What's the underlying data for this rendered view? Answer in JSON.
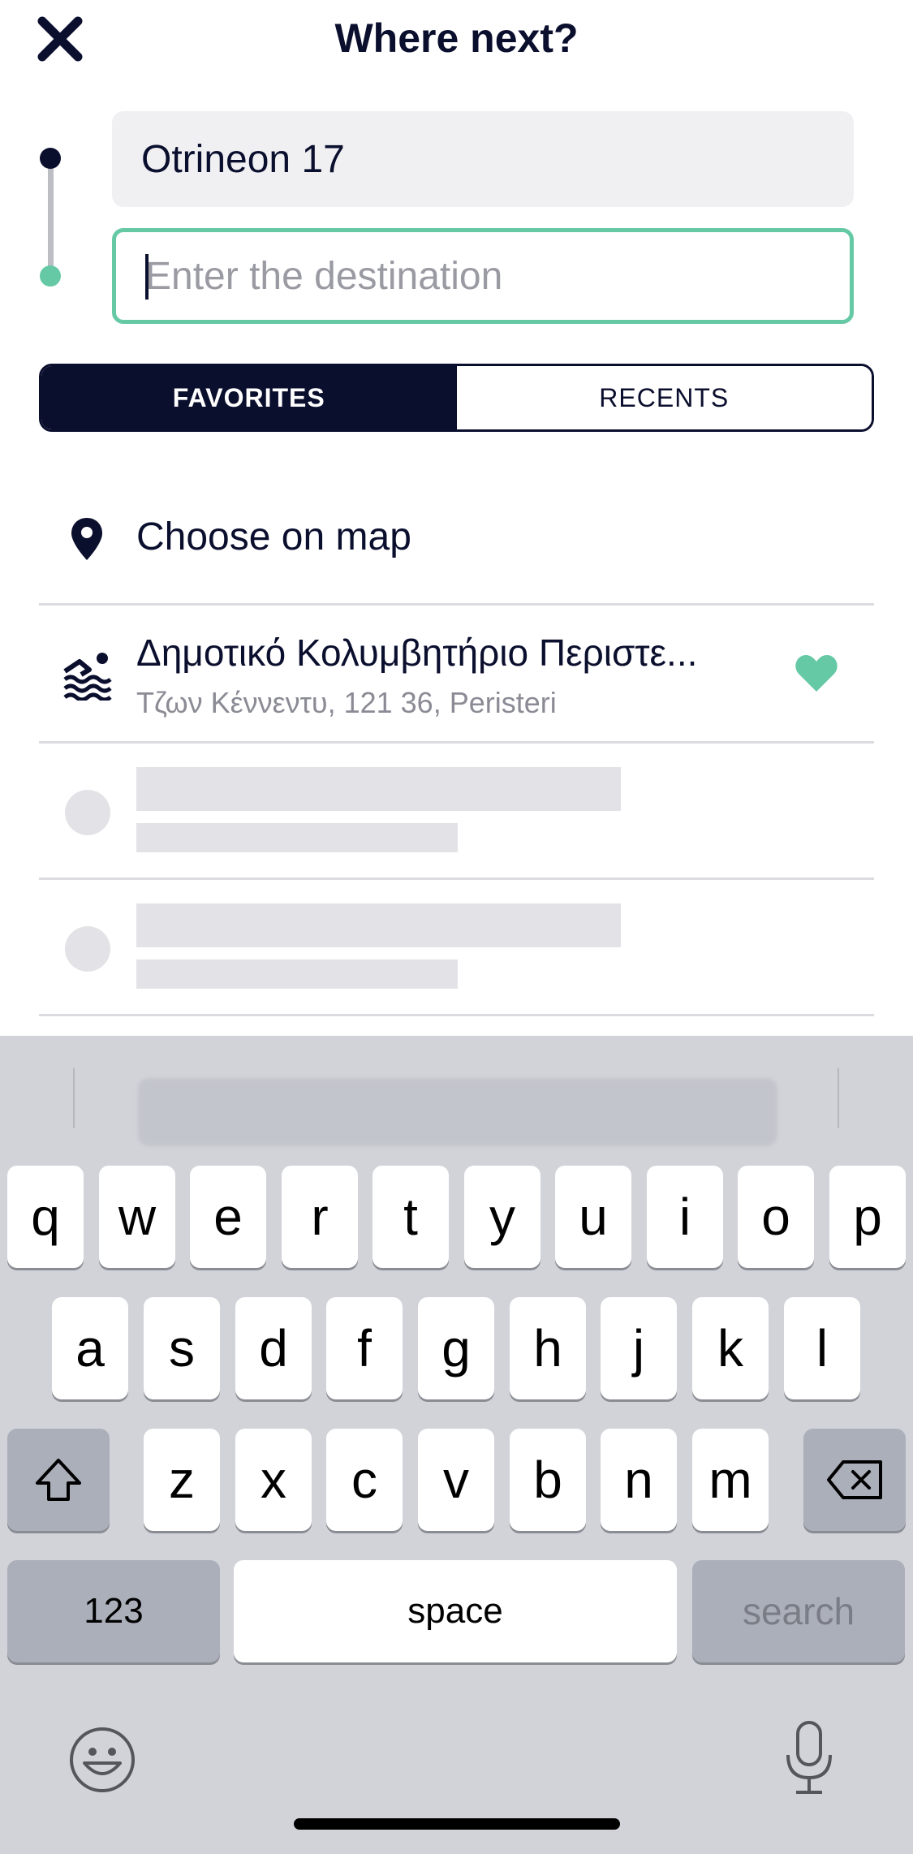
{
  "header": {
    "title": "Where next?"
  },
  "route": {
    "origin_value": "Otrineon 17",
    "destination_placeholder": "Enter the destination"
  },
  "tabs": [
    {
      "label": "FAVORITES",
      "active": true
    },
    {
      "label": "RECENTS",
      "active": false
    }
  ],
  "list": {
    "choose_on_map": "Choose on map",
    "favorites": [
      {
        "name": "Δημοτικό Κολυμβητήριο Περιστε...",
        "address": "Τζων Κέννεντυ, 121 36, Peristeri",
        "icon": "pool-icon",
        "favorite": true
      }
    ]
  },
  "keyboard": {
    "row1": [
      "q",
      "w",
      "e",
      "r",
      "t",
      "y",
      "u",
      "i",
      "o",
      "p"
    ],
    "row2": [
      "a",
      "s",
      "d",
      "f",
      "g",
      "h",
      "j",
      "k",
      "l"
    ],
    "row3": [
      "z",
      "x",
      "c",
      "v",
      "b",
      "n",
      "m"
    ],
    "numbers_label": "123",
    "space_label": "space",
    "search_label": "search"
  },
  "colors": {
    "brand_dark": "#0b0f2e",
    "accent_green": "#66c9a6",
    "keyboard_bg": "#d1d3d9"
  }
}
